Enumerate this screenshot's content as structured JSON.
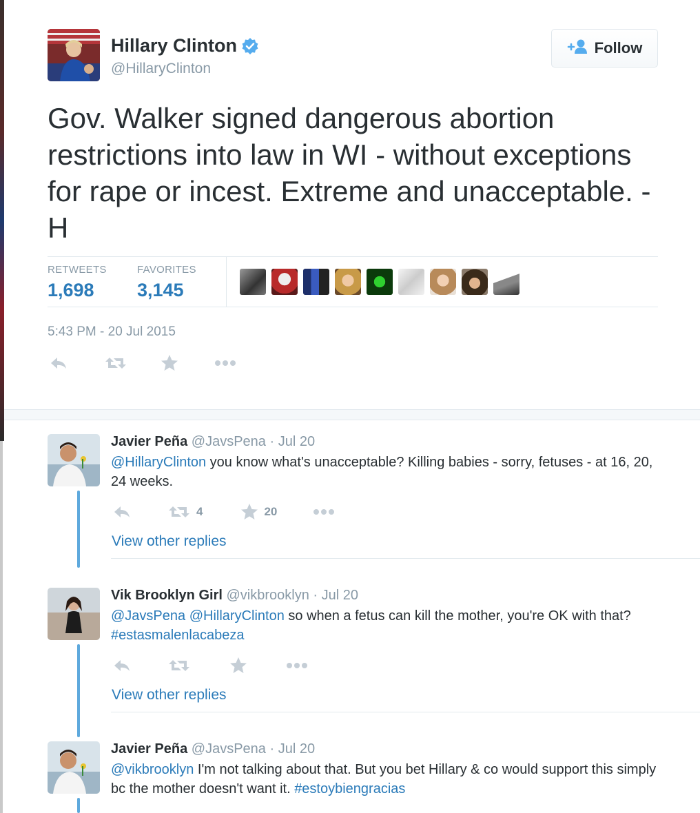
{
  "main_tweet": {
    "author_name": "Hillary Clinton",
    "handle": "@HillaryClinton",
    "follow_label": "Follow",
    "text": "Gov. Walker signed dangerous abortion restrictions into law in WI - without exceptions for rape or incest. Extreme and unacceptable. -H",
    "retweets_label": "RETWEETS",
    "retweets_count": "1,698",
    "favorites_label": "FAVORITES",
    "favorites_count": "3,145",
    "timestamp": "5:43 PM - 20 Jul 2015",
    "favoriter_avatars": [
      "bw-portrait",
      "santa",
      "blue-box",
      "blonde-woman",
      "green-lizard",
      "sketch",
      "woman-smiling",
      "man-dark-hair",
      "bw-landscape"
    ]
  },
  "replies": [
    {
      "name": "Javier Peña",
      "handle": "@JavsPena",
      "date": "Jul 20",
      "mention": "@HillaryClinton",
      "text": " you know what's unacceptable? Killing babies - sorry, fetuses - at 16, 20, 24 weeks.",
      "retweet_count": "4",
      "favorite_count": "20",
      "view_replies": "View other replies"
    },
    {
      "name": "Vik Brooklyn Girl",
      "handle": "@vikbrooklyn",
      "date": "Jul 20",
      "mention1": "@JavsPena",
      "mention2": "@HillaryClinton",
      "text": " so when a fetus can kill the mother, you're OK with that? ",
      "hashtag": "#estasmalenlacabeza",
      "view_replies": "View other replies"
    },
    {
      "name": "Javier Peña",
      "handle": "@JavsPena",
      "date": "Jul 20",
      "mention": "@vikbrooklyn",
      "text": " I'm not talking about that. But you bet Hillary & co would support this simply bc the mother doesn't want it. ",
      "hashtag": "#estoybiengracias"
    }
  ],
  "colors": {
    "link": "#2b7bb9",
    "muted": "#8899a6",
    "thread_line": "#5ea9dd",
    "text": "#292f33"
  }
}
